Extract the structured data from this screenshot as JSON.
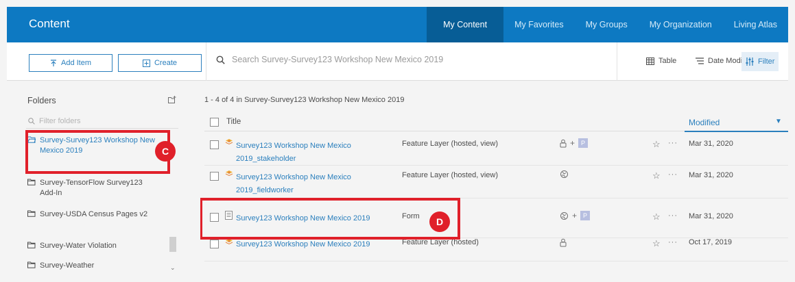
{
  "header": {
    "title": "Content",
    "nav": [
      "My Content",
      "My Favorites",
      "My Groups",
      "My Organization",
      "Living Atlas"
    ],
    "active_nav": "My Content"
  },
  "toolbar": {
    "add_item_label": "Add Item",
    "create_label": "Create",
    "search_placeholder": "Search Survey-Survey123 Workshop New Mexico 2019",
    "table_label": "Table",
    "date_modified_label": "Date Modified",
    "filter_label": "Filter"
  },
  "sidebar": {
    "title": "Folders",
    "filter_placeholder": "Filter folders",
    "folders": [
      {
        "label": "Survey-Survey123 Workshop New Mexico 2019",
        "active": true
      },
      {
        "label": "Survey-TensorFlow Survey123 Add-In",
        "active": false
      },
      {
        "label": "Survey-USDA Census Pages v2",
        "active": false
      },
      {
        "label": "Survey-Water Violation",
        "active": false
      },
      {
        "label": "Survey-Weather",
        "active": false
      }
    ]
  },
  "list": {
    "count_text": "1 - 4 of 4 in Survey-Survey123 Workshop New Mexico 2019",
    "columns": {
      "title": "Title",
      "modified": "Modified"
    },
    "rows": [
      {
        "title": "Survey123 Workshop New Mexico 2019_stakeholder",
        "type": "Feature Layer (hosted, view)",
        "modified": "Mar 31, 2020",
        "share": "private-plus-partner",
        "icon": "feature-layer-icon"
      },
      {
        "title": "Survey123 Workshop New Mexico 2019_fieldworker",
        "type": "Feature Layer (hosted, view)",
        "modified": "Mar 31, 2020",
        "share": "shared",
        "icon": "feature-layer-icon"
      },
      {
        "title": "Survey123 Workshop New Mexico 2019",
        "type": "Form",
        "modified": "Mar 31, 2020",
        "share": "shared-plus-partner",
        "icon": "form-icon"
      },
      {
        "title": "Survey123 Workshop New Mexico 2019",
        "type": "Feature Layer (hosted)",
        "modified": "Oct 17, 2019",
        "share": "private",
        "icon": "feature-layer-icon"
      }
    ]
  },
  "annotations": {
    "c": "C",
    "d": "D",
    "color": "#e0202a"
  },
  "partner_badge": "P",
  "colors": {
    "header_bg": "#0d79c2",
    "header_active": "#075d96",
    "link": "#2a7fbd"
  }
}
